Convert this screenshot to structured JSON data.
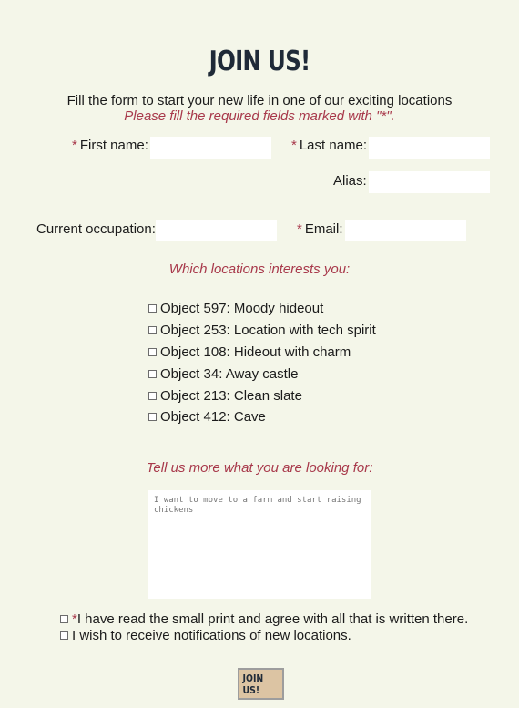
{
  "header": {
    "title": "JOIN US!",
    "intro": "Fill the form to start your new life in one of our exciting locations",
    "required_note": "Please fill the required fields marked with \"*\"."
  },
  "form": {
    "required_marker": "*",
    "first_name_label": "First name:",
    "last_name_label": "Last name:",
    "alias_label": "Alias:",
    "occupation_label": "Current occupation:",
    "email_label": "Email:",
    "first_name_value": "",
    "last_name_value": "",
    "alias_value": "",
    "occupation_value": "",
    "email_value": ""
  },
  "locations": {
    "heading": "Which locations interests you:",
    "items": [
      {
        "label": "Object 597: Moody hideout",
        "checked": false
      },
      {
        "label": "Object 253: Location with tech spirit",
        "checked": false
      },
      {
        "label": "Object 108: Hideout with charm",
        "checked": false
      },
      {
        "label": "Object 34: Away castle",
        "checked": false
      },
      {
        "label": "Object 213: Clean slate",
        "checked": false
      },
      {
        "label": "Object 412: Cave",
        "checked": false
      }
    ]
  },
  "details": {
    "heading": "Tell us more what you are looking for:",
    "placeholder": "I want to move to a farm and start raising chickens"
  },
  "consent": {
    "agree_label": "I have read the small print and agree with all that is written there.",
    "notify_label": "I wish to receive notifications of new locations."
  },
  "submit_label": "JOIN US!",
  "colors": {
    "background": "#f4f6e9",
    "accent": "#a8394b",
    "title": "#1f2a38",
    "button": "#dcc4a3"
  }
}
